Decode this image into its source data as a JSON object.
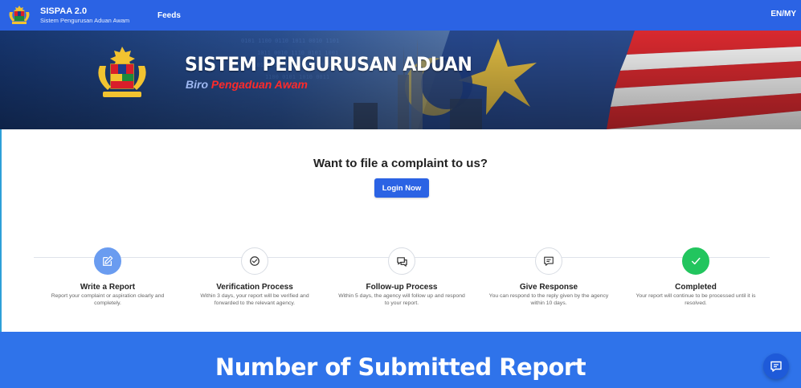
{
  "nav": {
    "brand_title": "SISPAA 2.0",
    "brand_subtitle": "Sistem Pengurusan Aduan Awam",
    "feeds_label": "Feeds",
    "language_label": "EN/MY"
  },
  "hero": {
    "title": "SISTEM PENGURUSAN ADUAN",
    "subtitle_word1": "Biro",
    "subtitle_word2": "Pengaduan Awam"
  },
  "cta": {
    "heading": "Want to file a complaint to us?",
    "login_label": "Login Now"
  },
  "steps": [
    {
      "title": "Write a Report",
      "description": "Report your complaint or aspiration clearly and completely.",
      "icon": "edit-icon",
      "state": "active"
    },
    {
      "title": "Verification Process",
      "description": "Within 3 days, your report will be verified and forwarded to the relevant agency.",
      "icon": "check-circle-icon",
      "state": "pending"
    },
    {
      "title": "Follow-up Process",
      "description": "Within 5 days, the agency will follow up and respond to your report.",
      "icon": "chat-bubbles-icon",
      "state": "pending"
    },
    {
      "title": "Give Response",
      "description": "You can respond to the reply given by the agency within 10 days.",
      "icon": "message-icon",
      "state": "pending"
    },
    {
      "title": "Completed",
      "description": "Your report will continue to be processed until it is resolved.",
      "icon": "check-icon",
      "state": "completed"
    }
  ],
  "stats": {
    "title": "Number of Submitted Report"
  },
  "colors": {
    "primary": "#2b63e4",
    "band": "#2f73ea",
    "active_step": "#6a9cf0",
    "completed_step": "#22c55e",
    "hero_subtitle_accent": "#ff2a2a"
  }
}
